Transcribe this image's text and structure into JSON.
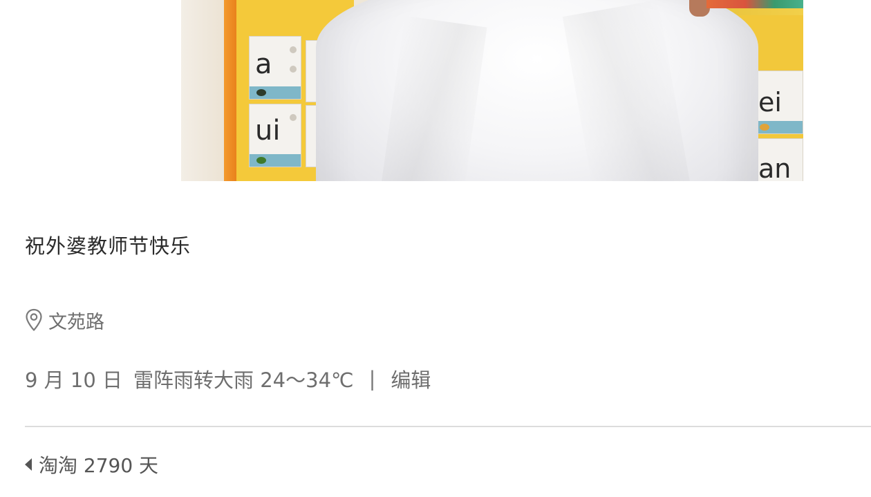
{
  "entry": {
    "title": "祝外婆教师节快乐",
    "location": {
      "icon": "location-pin-icon",
      "text": "文苑路"
    },
    "meta": {
      "date": "9 月 10 日",
      "weather": "雷阵雨转大雨 24～34℃",
      "separator": "|",
      "edit_label": "编辑"
    },
    "counter": {
      "icon": "caret-left-icon",
      "text": "淘淘 2790 天"
    }
  },
  "photo": {
    "card_letters": [
      "a",
      "ui",
      "ei",
      "an"
    ]
  },
  "colors": {
    "text_primary": "#2b2b2b",
    "text_secondary": "#6e6e6e",
    "divider": "#dcdcdc"
  }
}
